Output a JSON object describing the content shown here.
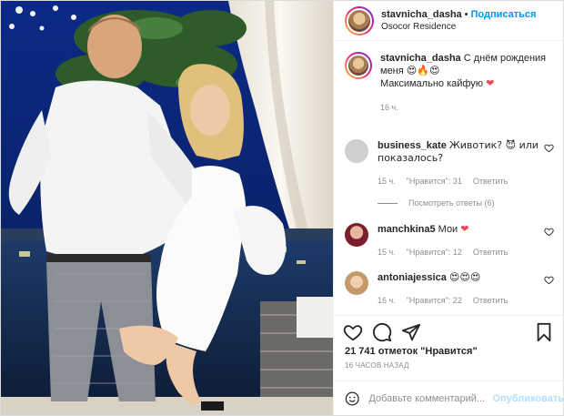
{
  "header": {
    "username": "stavnicha_dasha",
    "separator": "•",
    "follow_label": "Подписаться",
    "location": "Osocor Residence"
  },
  "caption": {
    "username": "stavnicha_dasha",
    "text_line1": "С днём рождения",
    "text_line2": "меня",
    "emojis_line2": "😍🔥😍",
    "text_line3": "Максимально кайфую",
    "emoji_line3": "❤",
    "time": "16 ч."
  },
  "comments": [
    {
      "username": "business_kate",
      "text": "Животик? 😈 или показалось?",
      "time": "15 ч.",
      "likes": "\"Нравится\": 31",
      "reply": "Ответить",
      "avatar_color": "#c9c9c9"
    },
    {
      "username": "manchkina5",
      "text": "Мои",
      "emoji": "❤",
      "time": "15 ч.",
      "likes": "\"Нравится\": 12",
      "reply": "Ответить",
      "avatar_color": "#b23a4a"
    },
    {
      "username": "antoniajessica",
      "text": "😍😍😍",
      "time": "16 ч.",
      "likes": "\"Нравится\": 22",
      "reply": "Ответить",
      "avatar_color": "#d9b48f"
    }
  ],
  "view_replies": "Посмотреть ответы (6)",
  "actions": {
    "like_icon": "heart-icon",
    "comment_icon": "comment-icon",
    "share_icon": "share-icon",
    "save_icon": "bookmark-icon"
  },
  "likes_count": "21 741 отметок \"Нравится\"",
  "post_time": "16 ЧАСОВ НАЗАД",
  "add_comment": {
    "placeholder": "Добавьте комментарий...",
    "publish_label": "Опубликовать"
  },
  "colors": {
    "accent": "#0095f6",
    "heart": "#ed4956",
    "muted": "#8e8e8e"
  }
}
